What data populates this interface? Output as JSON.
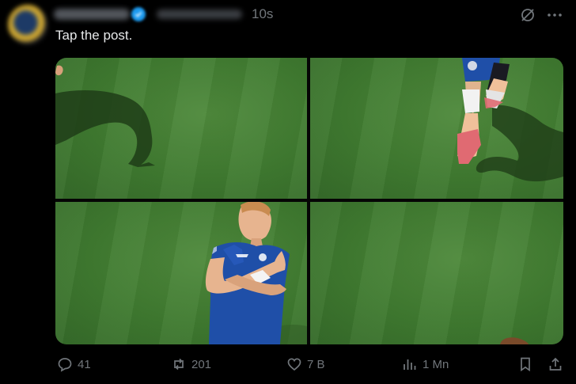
{
  "post": {
    "time": "10s",
    "text": "Tap the post."
  },
  "actions": {
    "replies": "41",
    "reposts": "201",
    "likes": "7 B",
    "views": "1 Mn"
  },
  "icons": [
    "avatar",
    "verified-icon",
    "grok-icon",
    "more-icon",
    "reply-icon",
    "repost-icon",
    "like-icon",
    "views-icon",
    "bookmark-icon",
    "share-icon"
  ],
  "colors": {
    "background": "#000000",
    "text": "#e7e9ea",
    "muted": "#71767b",
    "verified": "#1d9bf0",
    "grass": "#3f7a30",
    "kit_blue": "#1f4fa8"
  }
}
